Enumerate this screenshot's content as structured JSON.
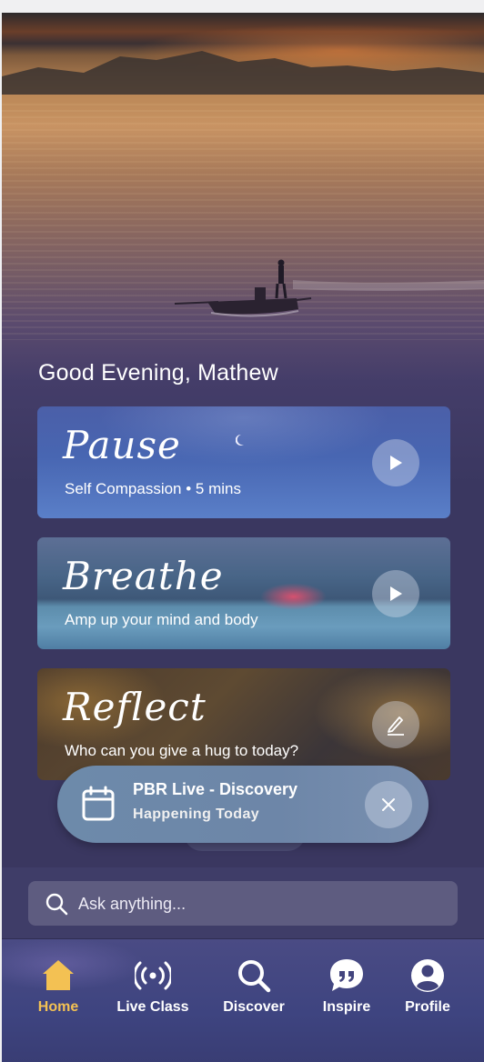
{
  "greeting": "Good Evening, Mathew",
  "cards": [
    {
      "title": "Pause",
      "subtitle": "Self Compassion  •  5 mins",
      "action_icon": "play-icon"
    },
    {
      "title": "Breathe",
      "subtitle": "Amp up your mind and body",
      "action_icon": "play-icon"
    },
    {
      "title": "Reflect",
      "subtitle": "Who can you give a hug to today?",
      "action_icon": "pencil-icon"
    }
  ],
  "toast": {
    "title": "PBR Live - Discovery",
    "subtitle": "Happening Today",
    "icon": "calendar-icon",
    "close_icon": "close-icon"
  },
  "search": {
    "placeholder": "Ask anything..."
  },
  "nav": {
    "active": "Home",
    "active_color": "#f3c153",
    "items": [
      {
        "label": "Home",
        "icon": "home-icon"
      },
      {
        "label": "Live Class",
        "icon": "live-broadcast-icon"
      },
      {
        "label": "Discover",
        "icon": "search-icon"
      },
      {
        "label": "Inspire",
        "icon": "quote-bubble-icon"
      },
      {
        "label": "Profile",
        "icon": "user-icon"
      }
    ]
  }
}
